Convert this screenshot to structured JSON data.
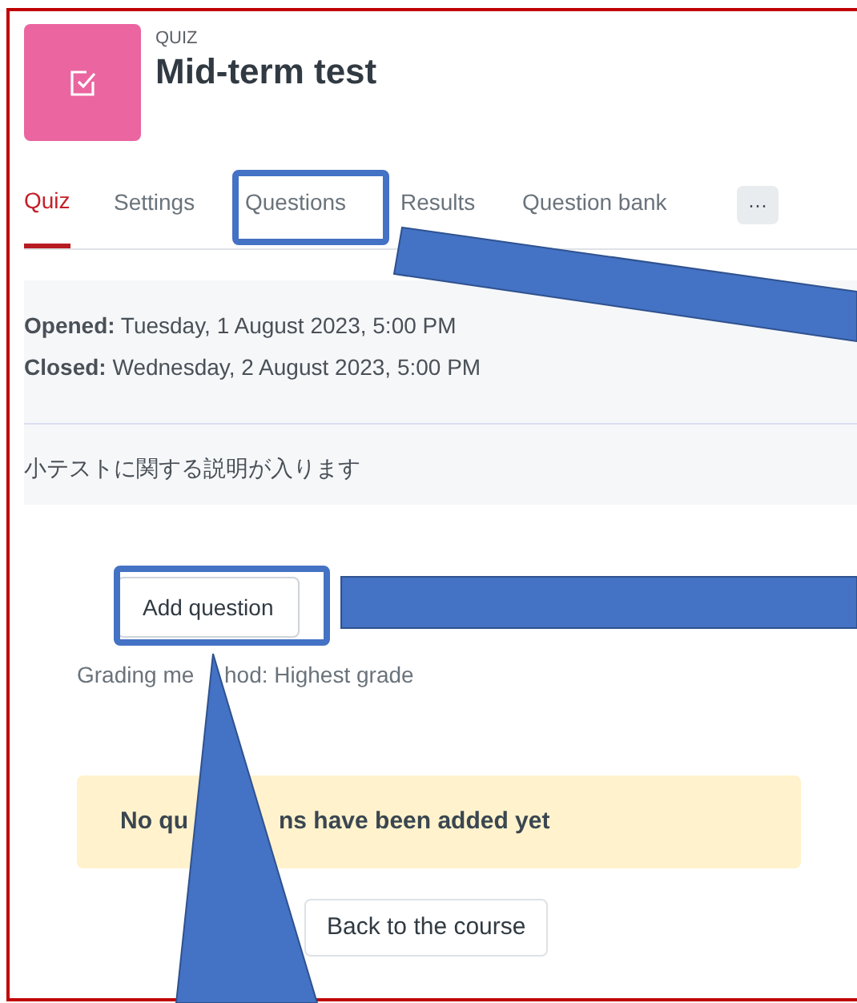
{
  "activity": {
    "type_label": "QUIZ",
    "title": "Mid-term test"
  },
  "tabs": [
    {
      "label": "Quiz",
      "selected": true
    },
    {
      "label": "Settings",
      "selected": false
    },
    {
      "label": "Questions",
      "selected": false
    },
    {
      "label": "Results",
      "selected": false
    },
    {
      "label": "Question bank",
      "selected": false
    }
  ],
  "more_button": "···",
  "dates": [
    "**Opened:** Tuesday, 1 August 2023, 5:00 PM",
    "**Closed:** Wednesday, 2 August 2023, 5:00 PM"
  ],
  "description": "小テストに関する説明が入ります",
  "add_question_button": "Add question",
  "grading_method_fragments": [
    "Grading me",
    "hod: Highest grade"
  ],
  "notice_fragments": [
    "No qu",
    "ns have been added yet"
  ],
  "back_button": "Back to the course"
}
